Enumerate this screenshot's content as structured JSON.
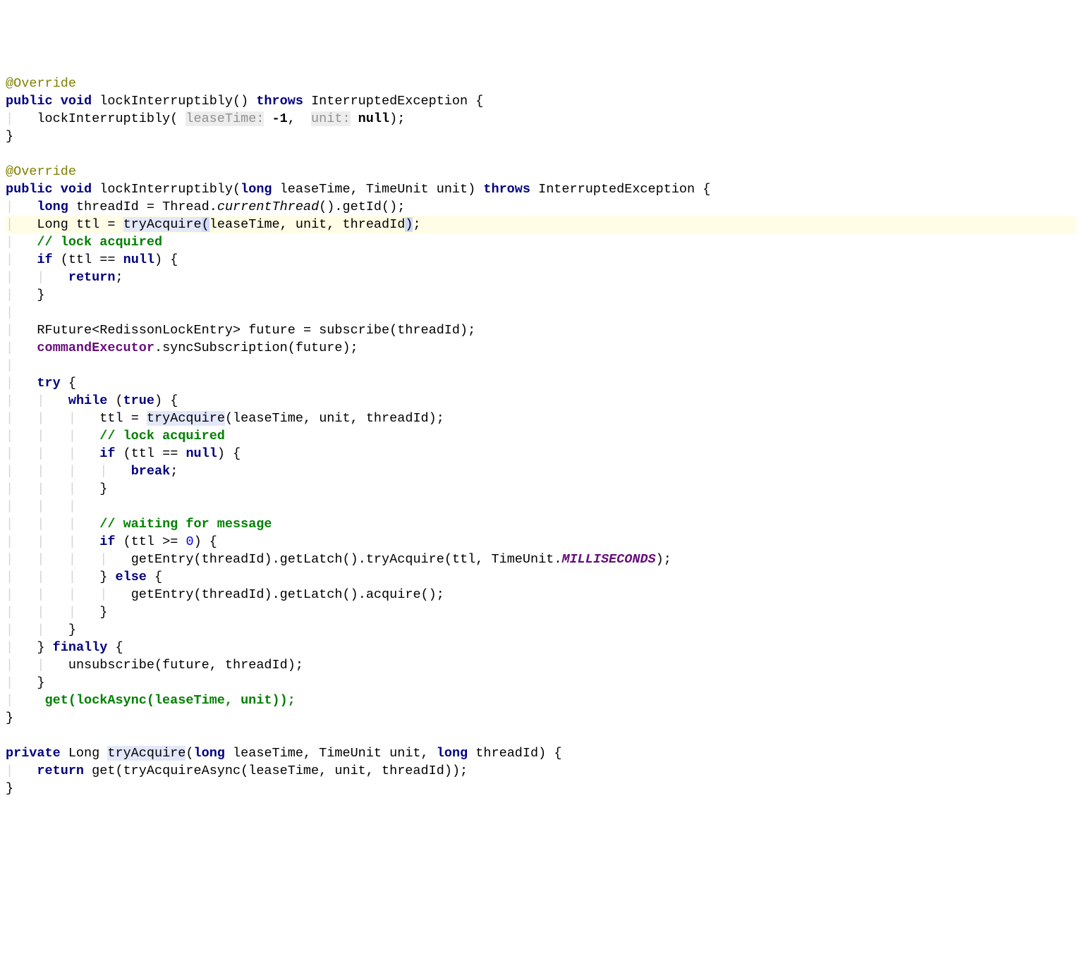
{
  "t": {
    "override": "@Override",
    "public": "public",
    "void": "void",
    "throws": "throws",
    "long_kw": "long",
    "if": "if",
    "null": "null",
    "return": "return",
    "try": "try",
    "while": "while",
    "true": "true",
    "break": "break",
    "else": "else",
    "finally": "finally",
    "private": "private"
  },
  "m": {
    "lockInterruptibly": "lockInterruptibly",
    "tryAcquire": "tryAcquire",
    "tryAcquireAsync": "tryAcquireAsync",
    "currentThread": "currentThread",
    "getId": "getId",
    "subscribe": "subscribe",
    "syncSubscription": "syncSubscription",
    "getEntry": "getEntry",
    "getLatch": "getLatch",
    "acquire": "acquire",
    "unsubscribe": "unsubscribe",
    "get": "get",
    "lockAsync": "lockAsync"
  },
  "ty": {
    "InterruptedException": "InterruptedException",
    "TimeUnit": "TimeUnit",
    "Thread": "Thread",
    "Long": "Long",
    "RFuture": "RFuture",
    "RedissonLockEntry": "RedissonLockEntry"
  },
  "v": {
    "leaseTime": "leaseTime",
    "unit": "unit",
    "threadId": "threadId",
    "ttl": "ttl",
    "future": "future"
  },
  "f": {
    "commandExecutor": "commandExecutor",
    "MILLISECONDS": "MILLISECONDS"
  },
  "h": {
    "leaseTime": "leaseTime:",
    "unit": "unit:"
  },
  "c": {
    "lockAcquired": "// lock acquired",
    "waiting": "// waiting for message",
    "getCall": "get(lockAsync(leaseTime, unit));"
  },
  "n": {
    "neg1": "-1",
    "zero": "0"
  },
  "p": {
    "op": "(",
    "cp": ")",
    "ob": "{",
    "cb": "}",
    "sc": ";",
    "comma": ",",
    "dot": ".",
    "eq": "=",
    "eqeq": "==",
    "geq": ">=",
    "lt": "<",
    "gt": ">"
  }
}
